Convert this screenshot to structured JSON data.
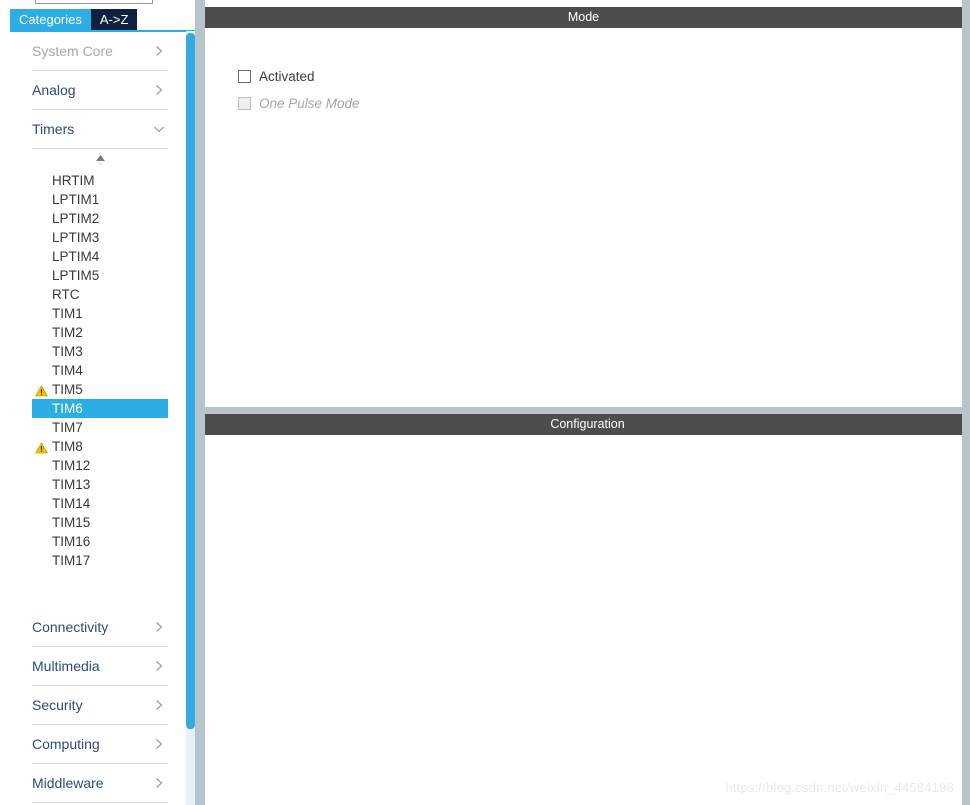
{
  "sidebar": {
    "search": {
      "value": "",
      "placeholder": ""
    },
    "tabs": [
      {
        "label": "Categories",
        "active": true
      },
      {
        "label": "A->Z",
        "active": false
      }
    ],
    "categories": [
      {
        "label": "System Core",
        "state": "disabled",
        "chevron": "chevron-right-icon"
      },
      {
        "label": "Analog",
        "state": "collapsed",
        "chevron": "chevron-right-icon"
      },
      {
        "label": "Timers",
        "state": "expanded",
        "chevron": "chevron-down-icon"
      }
    ],
    "scroll_up_icon": "scroll-up-arrow-icon",
    "peripherals": [
      {
        "label": "HRTIM",
        "warning": false,
        "selected": false
      },
      {
        "label": "LPTIM1",
        "warning": false,
        "selected": false
      },
      {
        "label": "LPTIM2",
        "warning": false,
        "selected": false
      },
      {
        "label": "LPTIM3",
        "warning": false,
        "selected": false
      },
      {
        "label": "LPTIM4",
        "warning": false,
        "selected": false
      },
      {
        "label": "LPTIM5",
        "warning": false,
        "selected": false
      },
      {
        "label": "RTC",
        "warning": false,
        "selected": false
      },
      {
        "label": "TIM1",
        "warning": false,
        "selected": false
      },
      {
        "label": "TIM2",
        "warning": false,
        "selected": false
      },
      {
        "label": "TIM3",
        "warning": false,
        "selected": false
      },
      {
        "label": "TIM4",
        "warning": false,
        "selected": false
      },
      {
        "label": "TIM5",
        "warning": true,
        "selected": false
      },
      {
        "label": "TIM6",
        "warning": false,
        "selected": true
      },
      {
        "label": "TIM7",
        "warning": false,
        "selected": false
      },
      {
        "label": "TIM8",
        "warning": true,
        "selected": false
      },
      {
        "label": "TIM12",
        "warning": false,
        "selected": false
      },
      {
        "label": "TIM13",
        "warning": false,
        "selected": false
      },
      {
        "label": "TIM14",
        "warning": false,
        "selected": false
      },
      {
        "label": "TIM15",
        "warning": false,
        "selected": false
      },
      {
        "label": "TIM16",
        "warning": false,
        "selected": false
      },
      {
        "label": "TIM17",
        "warning": false,
        "selected": false
      }
    ],
    "categories_bottom": [
      {
        "label": "Connectivity",
        "state": "collapsed",
        "chevron": "chevron-right-icon"
      },
      {
        "label": "Multimedia",
        "state": "collapsed",
        "chevron": "chevron-right-icon"
      },
      {
        "label": "Security",
        "state": "collapsed",
        "chevron": "chevron-right-icon"
      },
      {
        "label": "Computing",
        "state": "collapsed",
        "chevron": "chevron-right-icon"
      },
      {
        "label": "Middleware",
        "state": "collapsed",
        "chevron": "chevron-right-icon"
      }
    ]
  },
  "main": {
    "mode_panel": {
      "title": "Mode",
      "checkboxes": [
        {
          "label": "Activated",
          "checked": false,
          "disabled": false
        },
        {
          "label": "One Pulse Mode",
          "checked": false,
          "disabled": true
        }
      ]
    },
    "config_panel": {
      "title": "Configuration"
    }
  },
  "watermark": "https://blog.csdn.net/weixin_44584198",
  "colors": {
    "accent_blue": "#2cade3",
    "tab_inactive": "#0e2240",
    "panel_header": "#4d4d4d",
    "splitter": "#b8c4cc",
    "category_text": "#2e4a7d",
    "warning_yellow": "#f2c200"
  }
}
